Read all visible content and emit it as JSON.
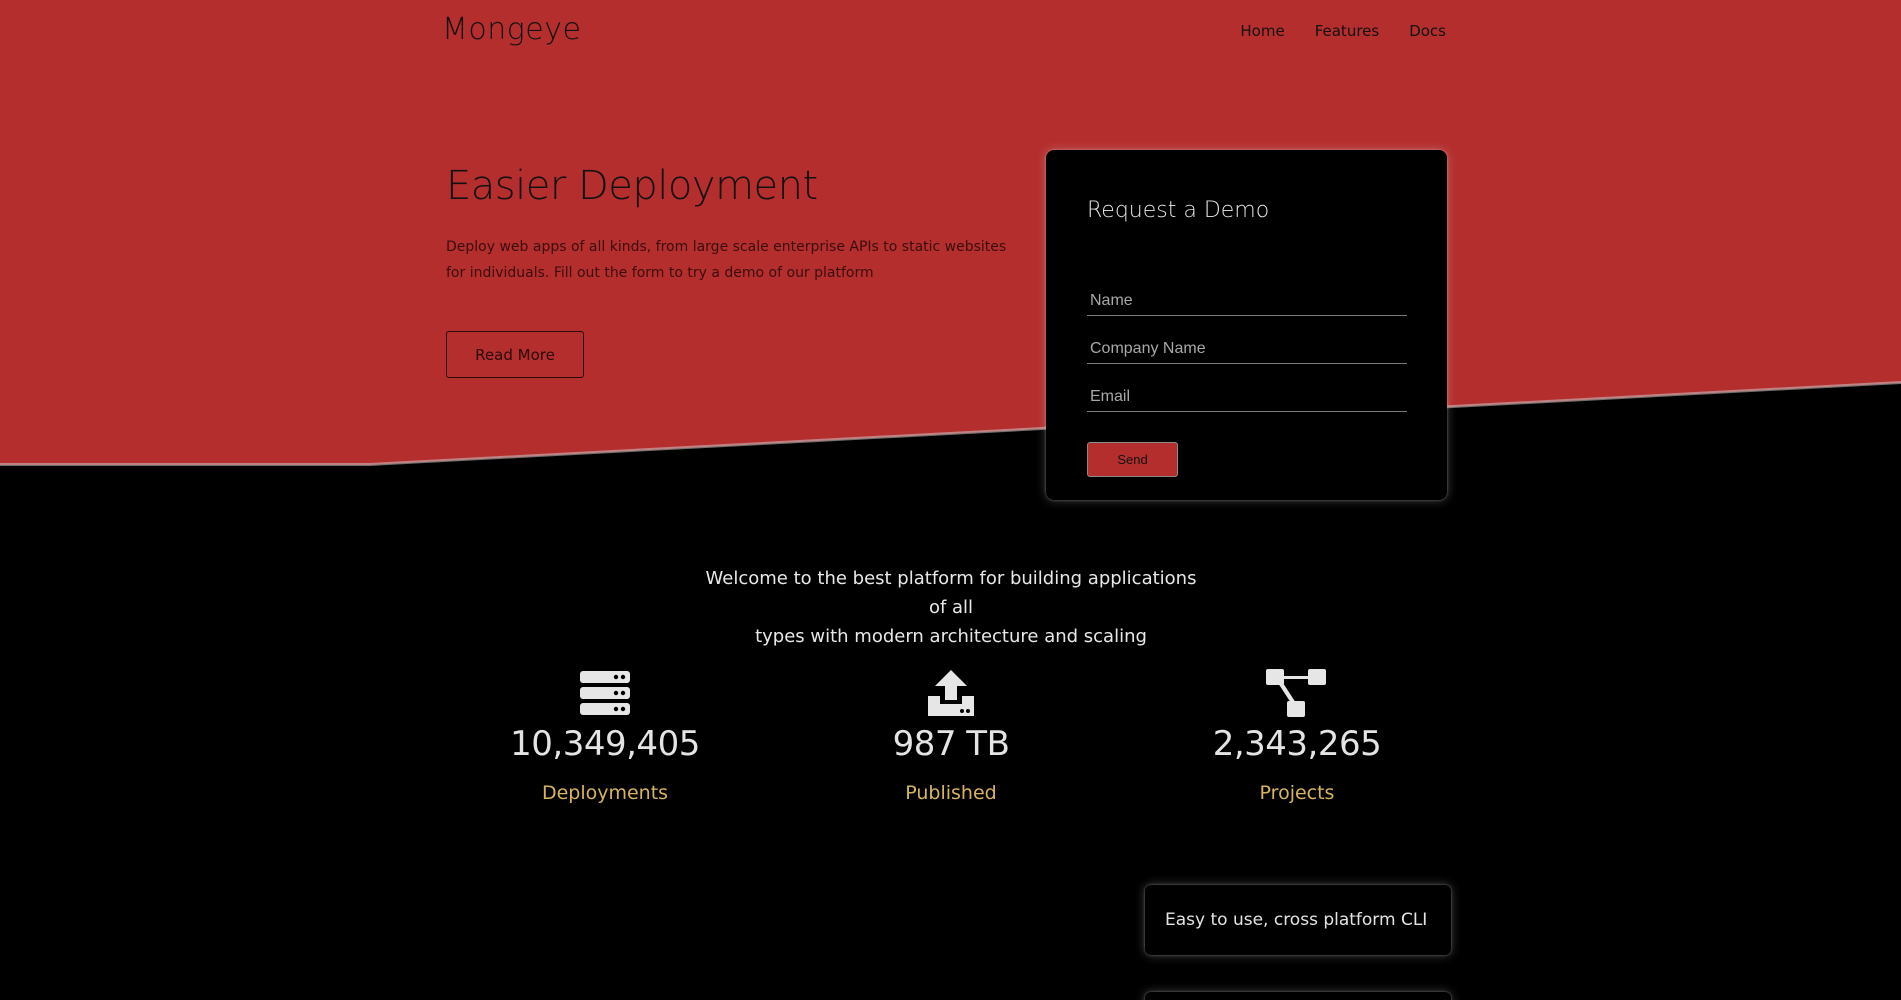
{
  "brand": {
    "logo": "Mongeye"
  },
  "nav": {
    "items": [
      "Home",
      "Features",
      "Docs"
    ]
  },
  "hero": {
    "title": "Easier Deployment",
    "text": "Deploy web apps of all kinds, from large scale enterprise APIs to static websites for individuals. Fill out the form to try a demo of our platform",
    "button": "Read More"
  },
  "demo_form": {
    "title": "Request a Demo",
    "name_placeholder": "Name",
    "company_placeholder": "Company Name",
    "email_placeholder": "Email",
    "send_label": "Send"
  },
  "welcome": {
    "line1": "Welcome to the best platform for building applications of all",
    "line2": "types with modern architecture and scaling"
  },
  "stats": [
    {
      "icon": "server-icon",
      "value": "10,349,405",
      "label": "Deployments"
    },
    {
      "icon": "upload-icon",
      "value": "987 TB",
      "label": "Published"
    },
    {
      "icon": "sitemap-icon",
      "value": "2,343,265",
      "label": "Projects"
    }
  ],
  "features": [
    {
      "text": "Easy to use, cross platform CLI"
    }
  ],
  "colors": {
    "accent": "#b52e2e",
    "gold": "#d8b461",
    "background": "#000000"
  }
}
